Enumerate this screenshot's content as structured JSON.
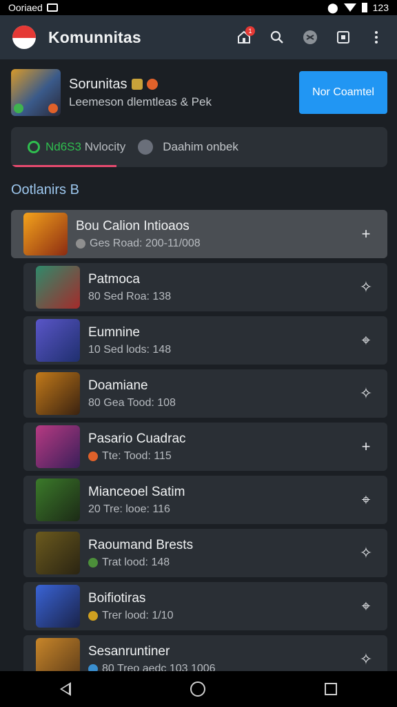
{
  "status_bar": {
    "left_text": "Ooriaed",
    "right_text": "123"
  },
  "header": {
    "title": "Komunnitas",
    "notification_count": "1",
    "actions": [
      "home-notification-icon",
      "search-icon",
      "gamepad-icon",
      "square-icon",
      "more-vert-icon"
    ]
  },
  "featured": {
    "title": "Sorunitas",
    "subtitle": "Leemeson dlemtleas & Pek",
    "button_label": "Nor Coamtel",
    "button_color": "#2196f3"
  },
  "info_card": {
    "status_label": "Nd6S3",
    "status_detail": "Nvlocity",
    "note": "Daahim onbek",
    "progress": 0.28
  },
  "section": {
    "title": "Ootlanirs B"
  },
  "list": [
    {
      "title": "Bou Calion Intioaos",
      "subtitle": "Ges Road: 200-11/008",
      "action_icon": "plus-icon",
      "action_glyph": "+",
      "selected": true,
      "thumb": [
        "#f4a31c",
        "#8c2c12"
      ],
      "dot": "#8f8f8f"
    },
    {
      "title": "Patmoca",
      "subtitle": "80 Sed Roa: 138",
      "action_icon": "settings-icon",
      "action_glyph": "✧",
      "selected": false,
      "thumb": [
        "#2f8a6b",
        "#a42b2b"
      ],
      "dot": ""
    },
    {
      "title": "Eumnine",
      "subtitle": "10 Sed lods: 148",
      "action_icon": "pin-icon",
      "action_glyph": "⌖",
      "selected": false,
      "thumb": [
        "#5a56c8",
        "#1f2f6e"
      ],
      "dot": ""
    },
    {
      "title": "Doamiane",
      "subtitle": "80 Gea Tood: 108",
      "action_icon": "settings-icon",
      "action_glyph": "✧",
      "selected": false,
      "thumb": [
        "#c27a1a",
        "#3a2210"
      ],
      "dot": ""
    },
    {
      "title": "Pasario Cuadrac",
      "subtitle": "Tte: Tood: 115",
      "action_icon": "plus-icon",
      "action_glyph": "+",
      "selected": false,
      "thumb": [
        "#b73a82",
        "#3a1f5a"
      ],
      "dot": "#e0612a"
    },
    {
      "title": "Mianceoel Satim",
      "subtitle": "20 Tre: looe: 116",
      "action_icon": "pin-icon",
      "action_glyph": "⌖",
      "selected": false,
      "thumb": [
        "#3b7a2a",
        "#1c2a16"
      ],
      "dot": ""
    },
    {
      "title": "Raoumand Brests",
      "subtitle": "Trat lood: 148",
      "action_icon": "settings-icon",
      "action_glyph": "✧",
      "selected": false,
      "thumb": [
        "#6b5a1e",
        "#2a2412"
      ],
      "dot": "#4c8f3a"
    },
    {
      "title": "Boifiotiras",
      "subtitle": "Trer lood: 1/10",
      "action_icon": "pin-icon",
      "action_glyph": "⌖",
      "selected": false,
      "thumb": [
        "#3a64d6",
        "#1a234a"
      ],
      "dot": "#d0a020"
    },
    {
      "title": "Sesanruntiner",
      "subtitle": "80 Treo aedc 103 1006",
      "action_icon": "settings-icon",
      "action_glyph": "✧",
      "selected": false,
      "thumb": [
        "#c8862a",
        "#5a3a18"
      ],
      "dot": "#3a8fd0"
    }
  ]
}
